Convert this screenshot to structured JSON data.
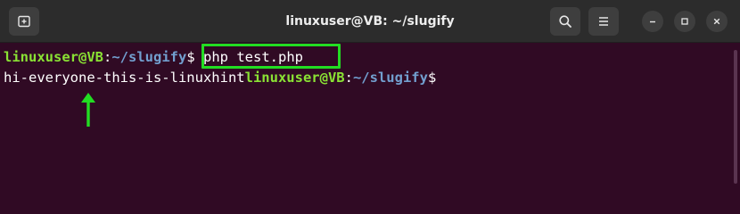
{
  "window": {
    "title": "linuxuser@VB: ~/slugify"
  },
  "titlebar": {
    "icons": [
      "new-tab-icon",
      "search-icon",
      "hamburger-menu-icon",
      "minimize-icon",
      "maximize-icon",
      "close-icon"
    ]
  },
  "terminal": {
    "prompt1": {
      "user_host": "linuxuser@VB",
      "colon": ":",
      "path": "~/slugify",
      "symbol": "$",
      "command": " php test.php"
    },
    "output": "hi-everyone-this-is-linuxhint",
    "prompt2": {
      "user_host": "linuxuser@VB",
      "colon": ":",
      "path": "~/slugify",
      "symbol": "$"
    }
  },
  "colors": {
    "background": "#300a24",
    "titlebar": "#2c2c2c",
    "user_host": "#8ae234",
    "path": "#729fcf",
    "annotation": "#22dd22"
  }
}
